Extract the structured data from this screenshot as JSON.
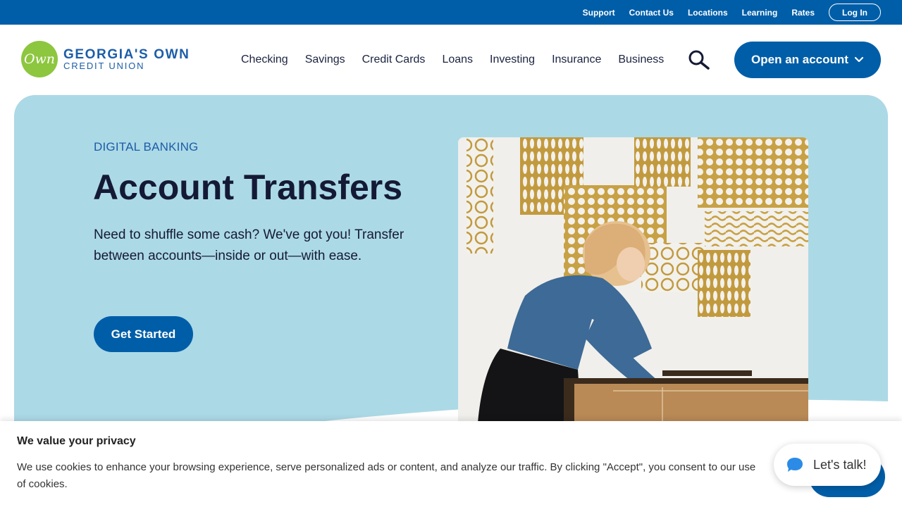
{
  "utility_nav": {
    "links": [
      "Support",
      "Contact Us",
      "Locations",
      "Learning",
      "Rates"
    ],
    "login_label": "Log In"
  },
  "logo": {
    "mark": "Own",
    "line1": "GEORGIA'S OWN",
    "line2": "CREDIT UNION"
  },
  "main_nav": {
    "items": [
      "Checking",
      "Savings",
      "Credit Cards",
      "Loans",
      "Investing",
      "Insurance",
      "Business"
    ],
    "search_icon": "search-icon",
    "open_account_label": "Open an account"
  },
  "hero": {
    "eyebrow": "DIGITAL BANKING",
    "title": "Account Transfers",
    "description": "Need to shuffle some cash? We've got you! Transfer between accounts—inside or out—with ease.",
    "cta_label": "Get Started"
  },
  "cookie_banner": {
    "title": "We value your privacy",
    "text": "We use cookies to enhance your browsing experience, serve personalized ads or content, and analyze our traffic. By clicking \"Accept\", you consent to our use of cookies."
  },
  "chat": {
    "label": "Let's talk!",
    "icon": "chat-bubble-icon"
  },
  "colors": {
    "primary": "#005ea8",
    "hero_bg": "#acd9e6",
    "logo_green": "#8dc63f",
    "text_dark": "#141a35"
  }
}
